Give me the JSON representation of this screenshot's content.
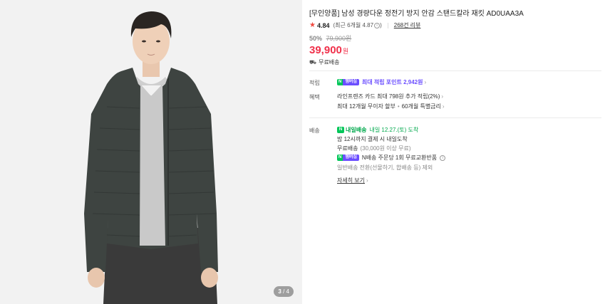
{
  "gallery": {
    "current": "3",
    "total": "4"
  },
  "product": {
    "title": "[무인양품] 남성 경량다운 정전기 방지 안감 스탠드칼라 재킷 AD0UAA3A",
    "rating": "4.84",
    "rating_recent": "(최근 6개월 4.87",
    "rating_recent_close": ")",
    "review_link": "268건 리뷰",
    "discount": "50%",
    "original_price": "79,900원",
    "price": "39,900",
    "currency": "원",
    "shipping": "무료배송"
  },
  "points": {
    "label": "적립",
    "badge_n": "N",
    "badge_m": "멤버십",
    "text": "최대 적립 포인트 2,942원"
  },
  "benefits": {
    "label": "혜택",
    "line1": "라인프렌즈 카드 최대 798원 추가 적립(2%)",
    "line2a": "최대 12개월 무이자 할부",
    "line2_sep": "•",
    "line2b": "60개월 특별금리"
  },
  "delivery": {
    "label": "배송",
    "arrive_badge_n": "N",
    "arrive_badge": "내일배송",
    "arrive_text": "내일 12.27.(토) 도착",
    "cutoff": "밤 12시까지 결제 시 내일도착",
    "free_shipping": "무료배송",
    "free_condition": "(30,000원 이상 무료)",
    "n_shipping_badge_n": "N",
    "n_shipping_badge_m": "멤버십",
    "n_shipping_text": "N배송 주문당 1회 무료교환반품",
    "switch_text": "일반배송 전환(선물하기, 합배송 등) 제외",
    "more": "자세히 보기"
  },
  "colors": {
    "price_red": "#f0304a",
    "membership_purple": "#6b4eff",
    "naver_green": "#03c75a"
  }
}
